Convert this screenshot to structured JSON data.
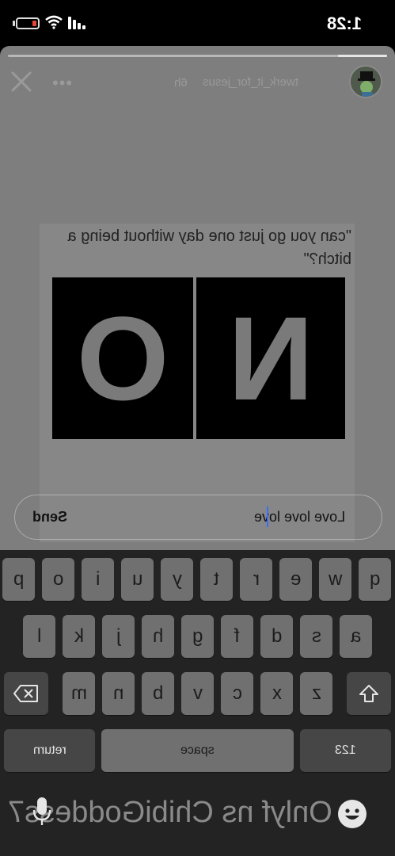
{
  "status_bar": {
    "time": "1:28",
    "battery_icon": "battery-low-icon",
    "wifi_icon": "wifi-icon",
    "signal_icon": "cellular-signal-icon"
  },
  "story": {
    "username": "twerk_it_for_jesus",
    "posted_ago": "6h",
    "progress": 0.13,
    "close_icon": "close-icon",
    "more_icon": "more-icon",
    "caption": "\"can you go just one day without being a bitch?\"",
    "tiles": [
      "N",
      "O"
    ]
  },
  "reply": {
    "input_value": "Love love love",
    "send_label": "Send"
  },
  "keyboard": {
    "row1": [
      "q",
      "w",
      "e",
      "r",
      "t",
      "y",
      "u",
      "i",
      "o",
      "p"
    ],
    "row2": [
      "a",
      "s",
      "d",
      "f",
      "g",
      "h",
      "j",
      "k",
      "l"
    ],
    "row3": [
      "z",
      "x",
      "c",
      "v",
      "b",
      "n",
      "m"
    ],
    "numbers_label": "123",
    "space_label": "space",
    "return_label": "return",
    "shift_icon": "shift-icon",
    "delete_icon": "delete-icon",
    "emoji_icon": "emoji-icon",
    "mic_icon": "microphone-icon",
    "dictation_text": "Onlyf ns ChibiGoddess7"
  }
}
